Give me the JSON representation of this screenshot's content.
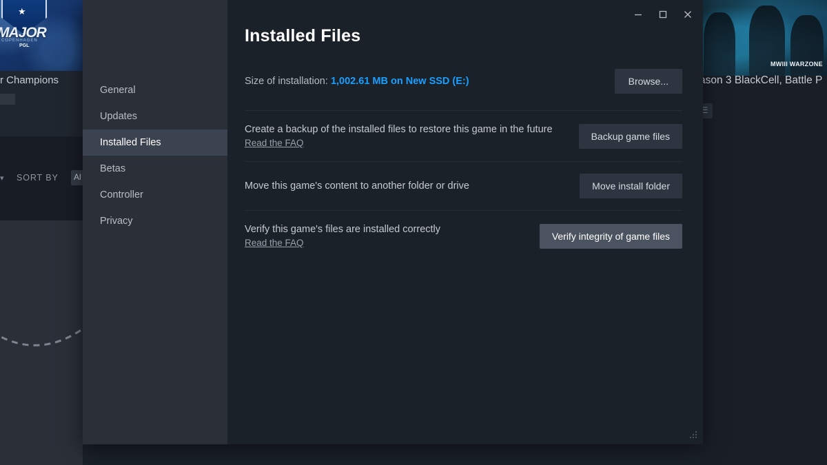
{
  "window": {
    "title": "Installed Files",
    "controls": [
      {
        "name": "minimize",
        "glyph": "–"
      },
      {
        "name": "maximize",
        "glyph": "☐"
      },
      {
        "name": "close",
        "glyph": "✕"
      }
    ]
  },
  "sidebar": {
    "items": [
      {
        "label": "General",
        "selected": false
      },
      {
        "label": "Updates",
        "selected": false
      },
      {
        "label": "Installed Files",
        "selected": true
      },
      {
        "label": "Betas",
        "selected": false
      },
      {
        "label": "Controller",
        "selected": false
      },
      {
        "label": "Privacy",
        "selected": false
      }
    ]
  },
  "main": {
    "title": "Installed Files",
    "size_row": {
      "label": "Size of installation:",
      "value": "1,002.61 MB on New SSD (E:)",
      "browse_button": "Browse..."
    },
    "rows": [
      {
        "title": "Create a backup of the installed files to restore this game in the future",
        "faq": "Read the FAQ",
        "button": "Backup game files",
        "hovered": false
      },
      {
        "title": "Move this game's content to another folder or drive",
        "faq": "",
        "button": "Move install folder",
        "hovered": false
      },
      {
        "title": "Verify this game's files are installed correctly",
        "faq": "Read the FAQ",
        "button": "Verify integrity of game files",
        "hovered": true
      }
    ]
  },
  "background": {
    "left": {
      "banner_word": "MAJOR",
      "banner_sub": "COPENHAGEN",
      "banner_league": "PGL",
      "game_title": "r Champions",
      "sort_label": "SORT BY",
      "sort_value": "Al"
    },
    "right": {
      "banner_logo": "MWIII WARZONE",
      "game_title": "ason 3 BlackCell, Battle P"
    }
  },
  "colors": {
    "dialog_bg": "#1b2129",
    "sidebar_bg": "#2a2f38",
    "sidebar_selected": "#3c4350",
    "button_bg": "#2e3541",
    "button_hover_bg": "#4b5360",
    "link_blue": "#1a9fff",
    "text_primary": "#ffffff",
    "text_secondary": "#b6bcc4"
  }
}
